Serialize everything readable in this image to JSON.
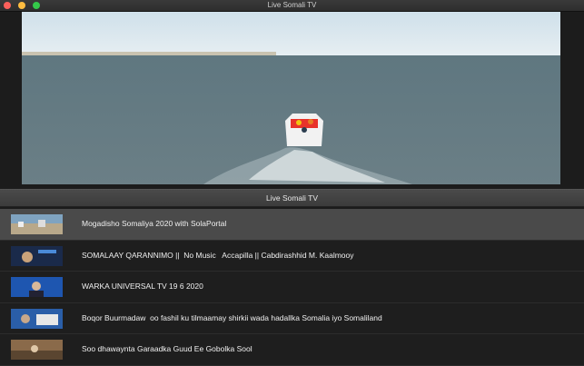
{
  "window": {
    "title": "Live Somali TV"
  },
  "section": {
    "title": "Live Somali TV"
  },
  "playlist": [
    {
      "title": "Mogadisho Somaliya 2020 with SolaPortal",
      "selected": true
    },
    {
      "title": "SOMALAAY QARANNIMO ||  No Music   Accapilla || Cabdirashhid M. Kaalmooy",
      "selected": false
    },
    {
      "title": "WARKA UNIVERSAL TV 19 6 2020",
      "selected": false
    },
    {
      "title": "Boqor Buurmadaw  oo fashil ku tilmaamay shirkii wada hadallka Somalia iyo Somaliland",
      "selected": false
    },
    {
      "title": "Soo dhawaynta Garaadka Guud Ee Gobolka Sool",
      "selected": false
    }
  ],
  "colors": {
    "accent_close": "#fc605b",
    "accent_min": "#fdbc40",
    "accent_max": "#34c84a",
    "selected_row": "#4a4a4a"
  }
}
